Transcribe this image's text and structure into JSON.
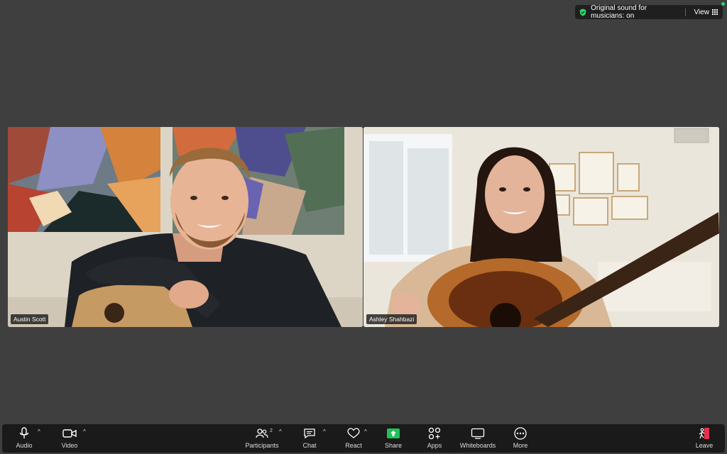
{
  "status_bar": {
    "sound_label": "Original sound for musicians: on",
    "view_label": "View"
  },
  "participants": [
    {
      "name": "Austin Scott"
    },
    {
      "name": "Ashley Shahbazi"
    }
  ],
  "toolbar": {
    "audio": "Audio",
    "video": "Video",
    "participants": "Participants",
    "participants_count": "2",
    "chat": "Chat",
    "react": "React",
    "share": "Share",
    "apps": "Apps",
    "whiteboards": "Whiteboards",
    "more": "More",
    "leave": "Leave"
  },
  "colors": {
    "background": "#3f3f3f",
    "toolbar": "#1a1a1a",
    "share_green": "#21c15a",
    "leave_red": "#e8304a",
    "shield_green": "#2fd565"
  }
}
